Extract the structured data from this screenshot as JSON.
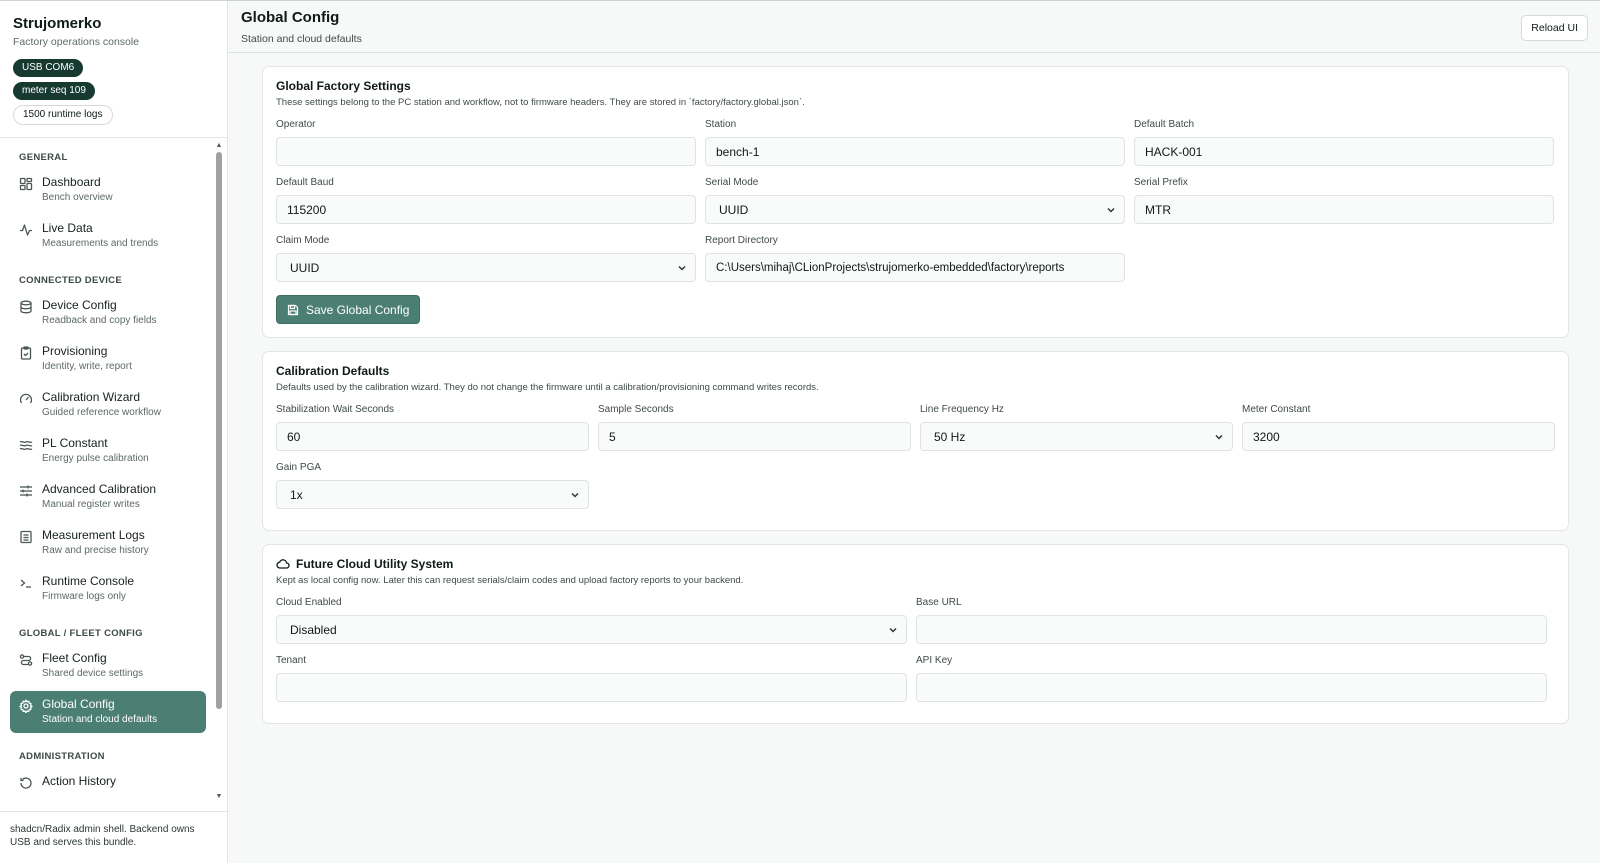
{
  "brand": {
    "title": "Strujomerko",
    "subtitle": "Factory operations console",
    "badges": [
      "USB COM6",
      "meter seq 109",
      "1500 runtime logs"
    ]
  },
  "sidebar": {
    "sections": [
      {
        "title": "GENERAL",
        "items": [
          {
            "label": "Dashboard",
            "sub": "Bench overview",
            "icon": "grid-icon"
          },
          {
            "label": "Live Data",
            "sub": "Measurements and trends",
            "icon": "activity-icon"
          }
        ]
      },
      {
        "title": "CONNECTED DEVICE",
        "items": [
          {
            "label": "Device Config",
            "sub": "Readback and copy fields",
            "icon": "database-icon"
          },
          {
            "label": "Provisioning",
            "sub": "Identity, write, report",
            "icon": "clipboard-check-icon"
          },
          {
            "label": "Calibration Wizard",
            "sub": "Guided reference workflow",
            "icon": "gauge-icon"
          },
          {
            "label": "PL Constant",
            "sub": "Energy pulse calibration",
            "icon": "waves-icon"
          },
          {
            "label": "Advanced Calibration",
            "sub": "Manual register writes",
            "icon": "sliders-icon"
          },
          {
            "label": "Measurement Logs",
            "sub": "Raw and precise history",
            "icon": "log-icon"
          },
          {
            "label": "Runtime Console",
            "sub": "Firmware logs only",
            "icon": "terminal-icon"
          }
        ]
      },
      {
        "title": "GLOBAL / FLEET CONFIG",
        "items": [
          {
            "label": "Fleet Config",
            "sub": "Shared device settings",
            "icon": "route-icon"
          },
          {
            "label": "Global Config",
            "sub": "Station and cloud defaults",
            "icon": "gear-icon",
            "active": true
          }
        ]
      },
      {
        "title": "ADMINISTRATION",
        "items": [
          {
            "label": "Action History",
            "sub": "",
            "icon": "history-icon"
          }
        ]
      }
    ],
    "footer": "shadcn/Radix admin shell. Backend owns USB and serves this bundle."
  },
  "header": {
    "title": "Global Config",
    "subtitle": "Station and cloud defaults",
    "reload_label": "Reload UI"
  },
  "global_settings": {
    "title": "Global Factory Settings",
    "description": "These settings belong to the PC station and workflow, not to firmware headers. They are stored in `factory/factory.global.json`.",
    "operator": {
      "label": "Operator",
      "value": ""
    },
    "station": {
      "label": "Station",
      "value": "bench-1"
    },
    "default_batch": {
      "label": "Default Batch",
      "value": "HACK-001"
    },
    "default_baud": {
      "label": "Default Baud",
      "value": "115200"
    },
    "serial_mode": {
      "label": "Serial Mode",
      "value": "UUID"
    },
    "serial_prefix": {
      "label": "Serial Prefix",
      "value": "MTR"
    },
    "claim_mode": {
      "label": "Claim Mode",
      "value": "UUID"
    },
    "report_directory": {
      "label": "Report Directory",
      "value": "C:\\Users\\mihaj\\CLionProjects\\strujomerko-embedded\\factory\\reports"
    },
    "save_label": "Save Global Config"
  },
  "calibration": {
    "title": "Calibration Defaults",
    "description": "Defaults used by the calibration wizard. They do not change the firmware until a calibration/provisioning command writes records.",
    "stabilization": {
      "label": "Stabilization Wait Seconds",
      "value": "60"
    },
    "sample": {
      "label": "Sample Seconds",
      "value": "5"
    },
    "line_freq": {
      "label": "Line Frequency Hz",
      "value": "50 Hz"
    },
    "meter_constant": {
      "label": "Meter Constant",
      "value": "3200"
    },
    "gain_pga": {
      "label": "Gain PGA",
      "value": "1x"
    }
  },
  "cloud": {
    "title": "Future Cloud Utility System",
    "description": "Kept as local config now. Later this can request serials/claim codes and upload factory reports to your backend.",
    "enabled": {
      "label": "Cloud Enabled",
      "value": "Disabled"
    },
    "base_url": {
      "label": "Base URL",
      "value": ""
    },
    "tenant": {
      "label": "Tenant",
      "value": ""
    },
    "api_key": {
      "label": "API Key",
      "value": ""
    }
  },
  "colors": {
    "accent": "#4c7f73",
    "badge_dark": "#173a30"
  }
}
